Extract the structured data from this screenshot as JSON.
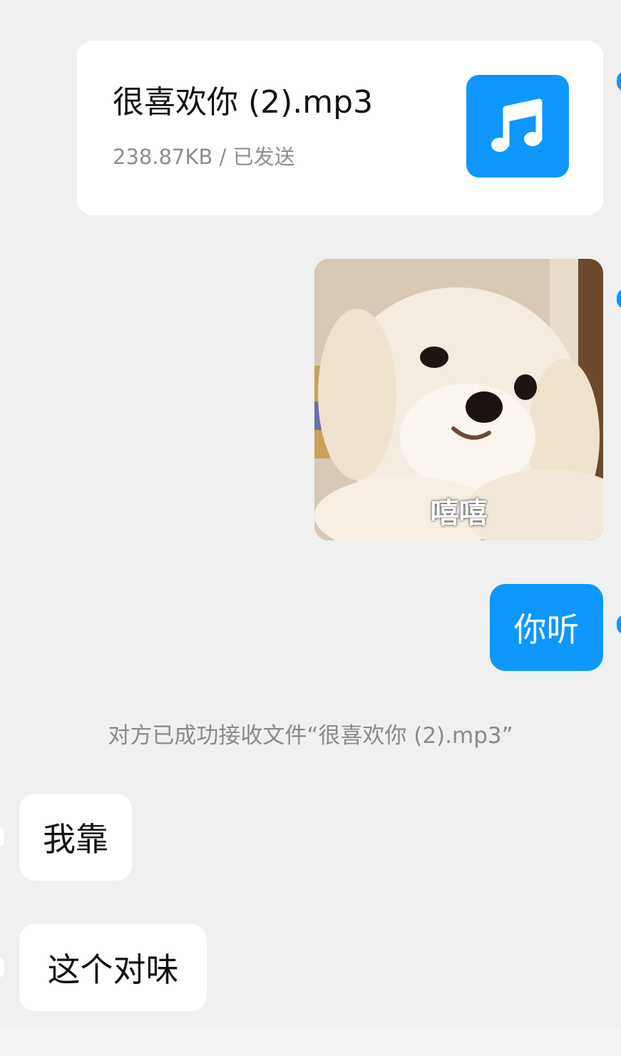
{
  "file_message": {
    "file_name": "很喜欢你 (2).mp3",
    "meta": "238.87KB / 已发送",
    "icon": "music-note-icon"
  },
  "sticker": {
    "caption": "嘻嘻"
  },
  "outgoing_text": "你听",
  "system_notice": "对方已成功接收文件“很喜欢你 (2).mp3”",
  "incoming_messages": [
    {
      "text": "我靠"
    },
    {
      "text": "这个对味"
    }
  ],
  "colors": {
    "accent_blue": "#0d97ff",
    "background": "#f0f0f0",
    "bubble_white": "#ffffff"
  }
}
